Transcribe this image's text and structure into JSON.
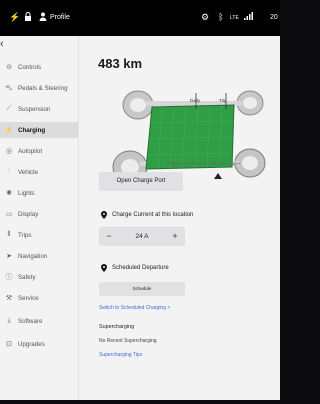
{
  "statusbar": {
    "profile_label": "Profile",
    "signal_label": "LTE",
    "time_partial": "20"
  },
  "sidebar": {
    "items": [
      {
        "label": "Controls",
        "icon": "toggle-icon"
      },
      {
        "label": "Pedals & Steering",
        "icon": "car-icon"
      },
      {
        "label": "Suspension",
        "icon": "suspension-icon"
      },
      {
        "label": "Charging",
        "icon": "bolt-icon",
        "active": true
      },
      {
        "label": "Autopilot",
        "icon": "steering-wheel-icon"
      },
      {
        "label": "Vehicle",
        "icon": "vehicle-icon"
      },
      {
        "label": "Lights",
        "icon": "bulb-icon"
      },
      {
        "label": "Display",
        "icon": "display-icon"
      },
      {
        "label": "Trips",
        "icon": "trips-icon"
      },
      {
        "label": "Navigation",
        "icon": "navigation-icon"
      },
      {
        "label": "Safety",
        "icon": "safety-icon"
      },
      {
        "label": "Service",
        "icon": "wrench-icon"
      },
      {
        "label": "Software",
        "icon": "download-icon"
      },
      {
        "label": "Upgrades",
        "icon": "lock-icon"
      }
    ]
  },
  "charging": {
    "range": "483 km",
    "daily_label": "Daily",
    "trip_label": "Trip",
    "hint": "Charging to this level will take longer",
    "open_port_label": "Open Charge Port",
    "current_label": "Charge Current at this location",
    "current_value": "24 A",
    "minus": "−",
    "plus": "+",
    "scheduled_label": "Scheduled Departure",
    "schedule_button": "Schedule",
    "switch_link": "Switch to Scheduled Charging >",
    "supercharging_title": "Supercharging",
    "no_recent": "No Recent Supercharging",
    "tips_link": "Supercharging Tips",
    "battery_color": "#2f9e45",
    "accent": "#3e6ad6"
  }
}
